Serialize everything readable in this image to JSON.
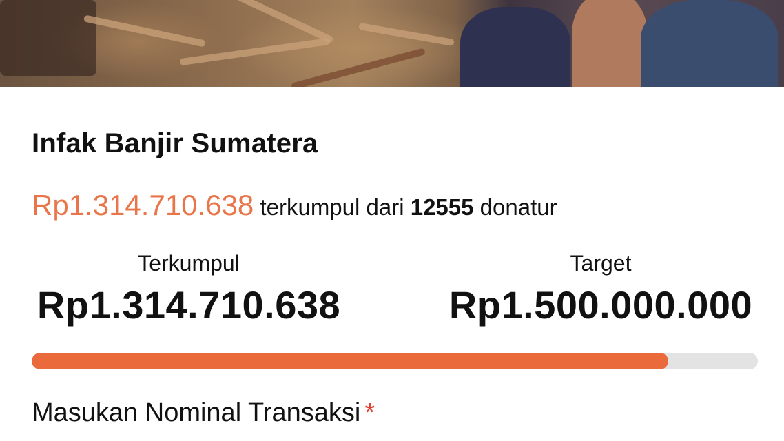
{
  "campaign": {
    "title": "Infak Banjir Sumatera",
    "collected_amount": "Rp1.314.710.638",
    "collected_text": "terkumpul dari",
    "donor_count": "12555",
    "donor_label": "donatur"
  },
  "stats": {
    "collected_label": "Terkumpul",
    "collected_value": "Rp1.314.710.638",
    "target_label": "Target",
    "target_value": "Rp1.500.000.000"
  },
  "progress": {
    "fraction": 0.8765
  },
  "form": {
    "amount_label": "Masukan Nominal Transaksi",
    "required_mark": "*"
  },
  "colors": {
    "accent": "#ea6a3c",
    "amount_text": "#e8764a",
    "required": "#e23b2e",
    "track": "#e3e3e3"
  }
}
